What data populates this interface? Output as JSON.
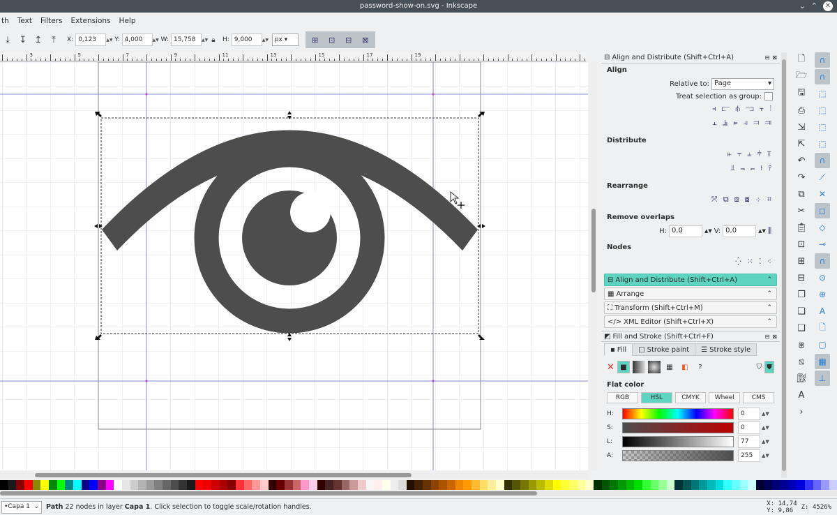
{
  "window": {
    "title": "password-show-on.svg - Inkscape"
  },
  "menu": [
    "th",
    "Text",
    "Filters",
    "Extensions",
    "Help"
  ],
  "toolcontrols": {
    "x_label": "X:",
    "x_value": "0,123",
    "y_label": "Y:",
    "y_value": "4,000",
    "w_label": "W:",
    "w_value": "15,758",
    "h_label": "H:",
    "h_value": "9,000",
    "unit": "px"
  },
  "ruler": {
    "numbers": [
      "3",
      "5",
      "7",
      "9",
      "11",
      "13",
      "15",
      "17",
      "19"
    ]
  },
  "align_panel": {
    "title": "Align and Distribute (Shift+Ctrl+A)",
    "align_heading": "Align",
    "relative_label": "Relative to:",
    "relative_value": "Page",
    "treat_group_label": "Treat selection as group:",
    "distribute_heading": "Distribute",
    "rearrange_heading": "Rearrange",
    "remove_overlaps_heading": "Remove overlaps",
    "h_label": "H:",
    "h_value": "0,0",
    "v_label": "V:",
    "v_value": "0,0",
    "nodes_heading": "Nodes"
  },
  "collapsed_dialogs": [
    {
      "label": "Align and Distribute (Shift+Ctrl+A)",
      "active": true
    },
    {
      "label": "Arrange",
      "active": false
    },
    {
      "label": "Transform (Shift+Ctrl+M)",
      "active": false
    },
    {
      "label": "XML Editor (Shift+Ctrl+X)",
      "active": false
    }
  ],
  "fill_stroke": {
    "title": "Fill and Stroke (Shift+Ctrl+F)",
    "tabs": [
      "Fill",
      "Stroke paint",
      "Stroke style"
    ],
    "flat_color_label": "Flat color",
    "modes": [
      "RGB",
      "HSL",
      "CMYK",
      "Wheel",
      "CMS"
    ],
    "active_mode": "HSL",
    "sliders": [
      {
        "label": "H:",
        "value": "0"
      },
      {
        "label": "S:",
        "value": "0"
      },
      {
        "label": "L:",
        "value": "77"
      },
      {
        "label": "A:",
        "value": "255"
      }
    ]
  },
  "status": {
    "layer": "•Capa 1",
    "message_prefix": "Path",
    "message_mid": " 22 nodes in layer ",
    "message_layer": "Capa 1",
    "message_suffix": ". Click selection to toggle scale/rotation handles.",
    "x_label": "X:",
    "x_value": "14,74",
    "y_label": "Y:",
    "y_value": "9,86",
    "zoom_label": "Z:",
    "zoom_value": "4526%"
  },
  "colors": {
    "shape": "#4d4d4d",
    "accent": "#5fd4c0",
    "titlebar": "#475057"
  }
}
